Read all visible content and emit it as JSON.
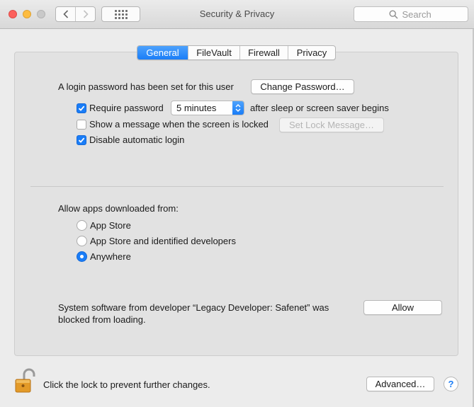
{
  "window": {
    "title": "Security & Privacy",
    "search_placeholder": "Search"
  },
  "tabs": [
    {
      "label": "General",
      "active": true
    },
    {
      "label": "FileVault",
      "active": false
    },
    {
      "label": "Firewall",
      "active": false
    },
    {
      "label": "Privacy",
      "active": false
    }
  ],
  "general": {
    "login_password_text": "A login password has been set for this user",
    "change_password_label": "Change Password…",
    "require_password": {
      "label": "Require password",
      "checked": true
    },
    "require_password_delay": "5 minutes",
    "after_sleep_text": "after sleep or screen saver begins",
    "show_message": {
      "label": "Show a message when the screen is locked",
      "checked": false
    },
    "set_lock_message_label": "Set Lock Message…",
    "disable_auto_login": {
      "label": "Disable automatic login",
      "checked": true
    }
  },
  "apps": {
    "heading": "Allow apps downloaded from:",
    "options": [
      {
        "label": "App Store",
        "selected": false
      },
      {
        "label": "App Store and identified developers",
        "selected": false
      },
      {
        "label": "Anywhere",
        "selected": true
      }
    ]
  },
  "system_software": {
    "line1": "System software from developer “Legacy Developer: Safenet” was",
    "line2": "blocked from loading.",
    "allow_label": "Allow"
  },
  "footer": {
    "lock_text": "Click the lock to prevent further changes.",
    "advanced_label": "Advanced…",
    "help_label": "?"
  },
  "colors": {
    "accent": "#1a7df7",
    "close": "#fc605c",
    "minimize": "#fdbc40",
    "lock": "#e39a28"
  },
  "icons": [
    "back-icon",
    "forward-icon",
    "grid-icon",
    "search-icon",
    "checkmark-icon",
    "popup-arrows-icon",
    "unlocked-padlock-icon",
    "help-icon"
  ]
}
